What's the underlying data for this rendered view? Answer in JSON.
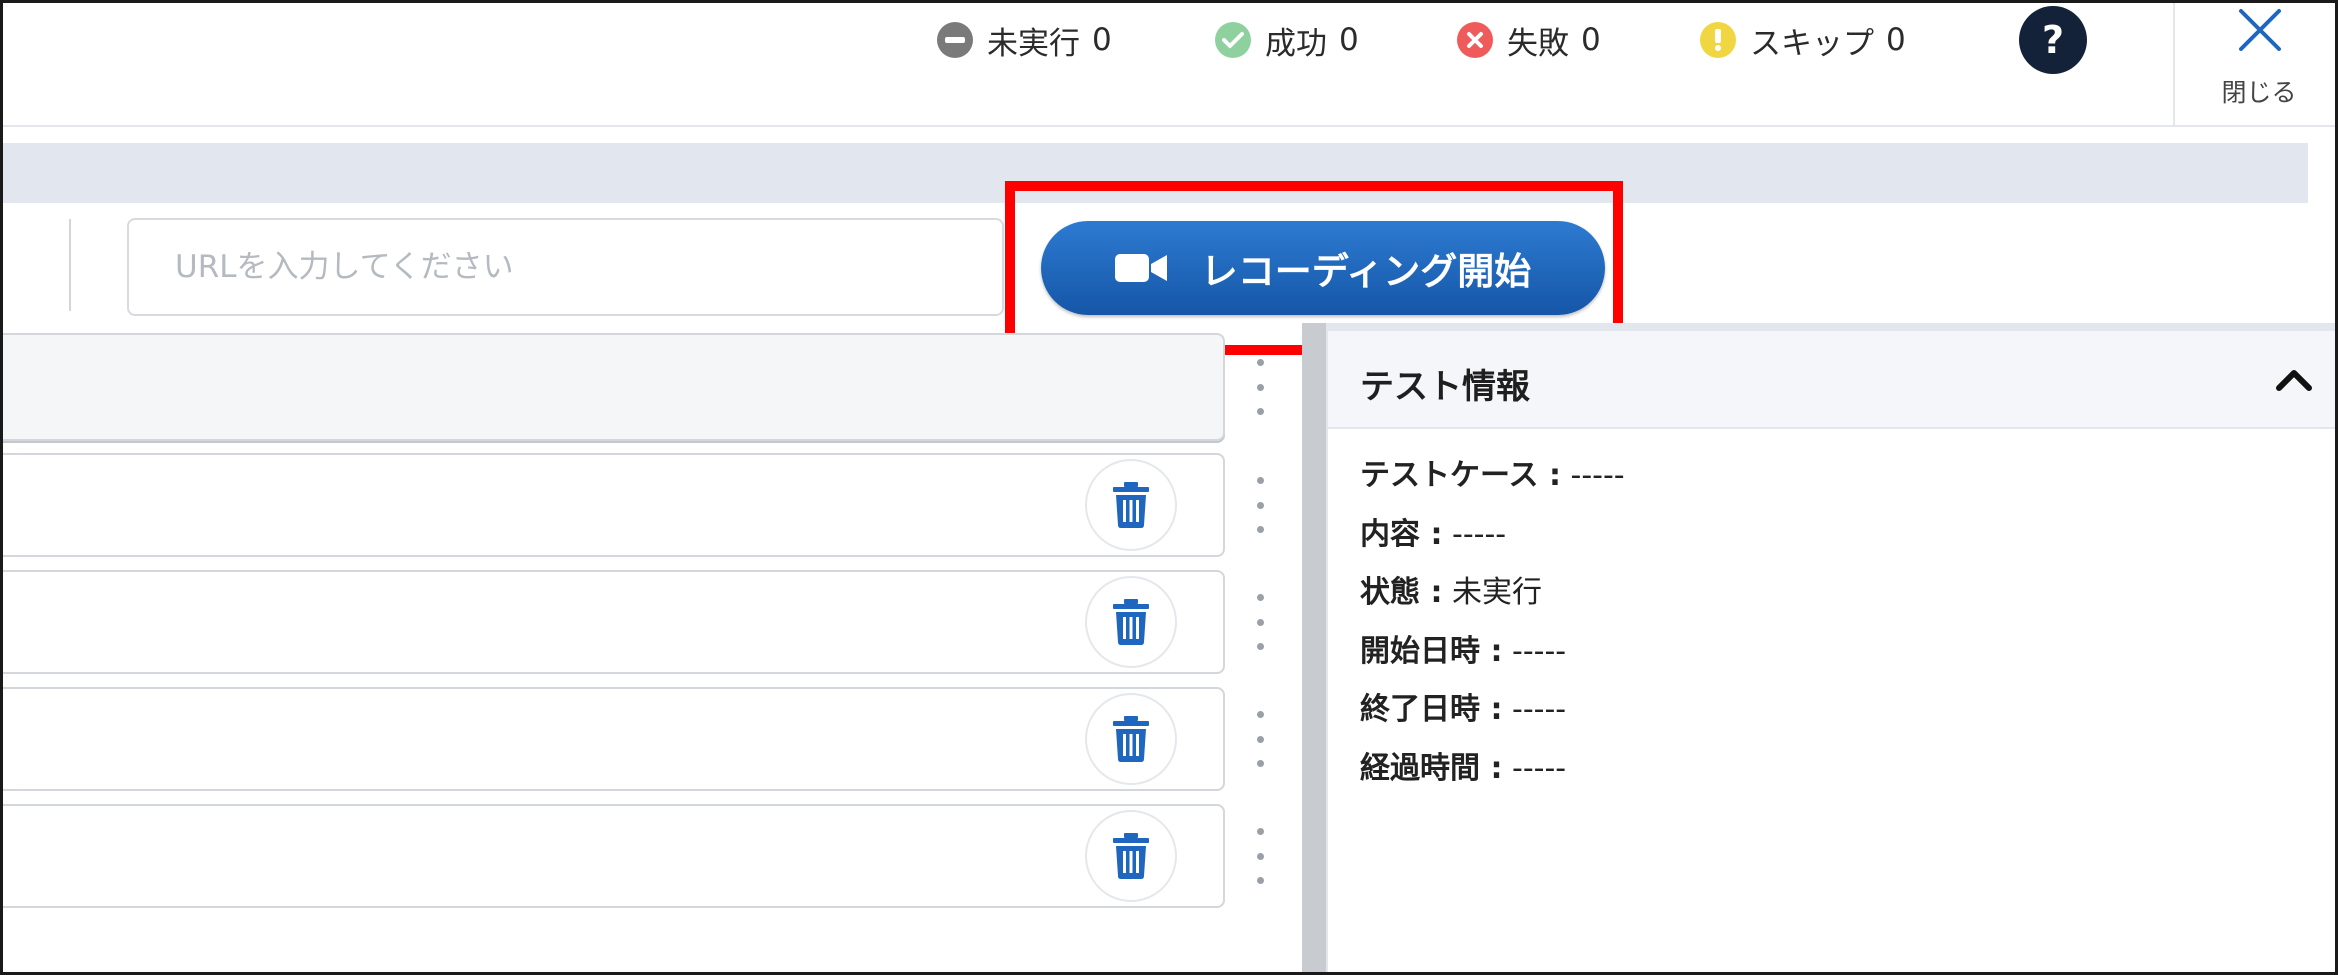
{
  "status": {
    "pending": {
      "label": "未実行",
      "count": "0",
      "color": "#7a7a7a"
    },
    "success": {
      "label": "成功",
      "count": "0",
      "color": "#8fd19e"
    },
    "fail": {
      "label": "失敗",
      "count": "0",
      "color": "#ef5a5a"
    },
    "skip": {
      "label": "スキップ",
      "count": "0",
      "color": "#f0d640"
    }
  },
  "help": {
    "label": "?"
  },
  "close": {
    "label": "閉じる"
  },
  "toolbar": {
    "url_placeholder": "URLを入力してください",
    "url_value": "",
    "record_label": "レコーディング開始",
    "record_color": "#1e66be",
    "highlight_color": "#ff0000"
  },
  "steps": [
    {
      "id": "1"
    },
    {
      "id": "2"
    },
    {
      "id": "3"
    },
    {
      "id": "4"
    }
  ],
  "info_panel": {
    "title": "テスト情報",
    "fields": [
      {
        "label": "テストケース :",
        "value": " -----"
      },
      {
        "label": "内容 :",
        "value": " -----"
      },
      {
        "label": "状態 :",
        "value": " 未実行"
      },
      {
        "label": "開始日時 :",
        "value": " -----"
      },
      {
        "label": "終了日時 :",
        "value": " -----"
      },
      {
        "label": "経過時間 :",
        "value": " -----"
      }
    ]
  }
}
